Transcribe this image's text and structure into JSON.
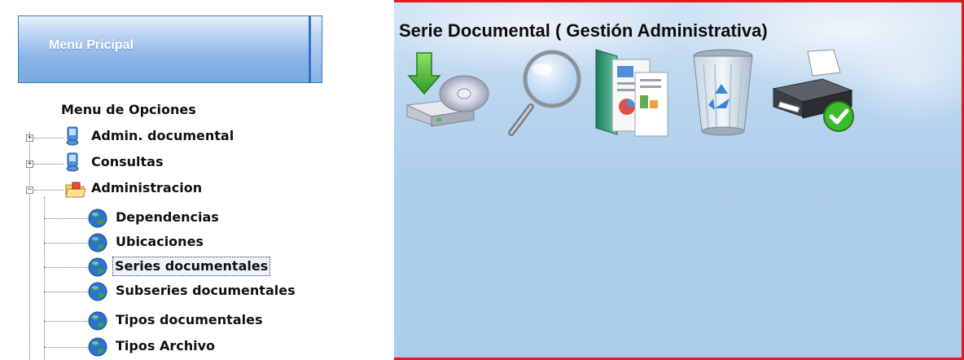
{
  "sidebar": {
    "header_title": "Menú Pricipal",
    "tree_title": "Menu de Opciones",
    "nodes": [
      {
        "label": "Admin. documental",
        "expander": "+",
        "icon": "monitor-icon"
      },
      {
        "label": "Consultas",
        "expander": "+",
        "icon": "monitor-icon"
      },
      {
        "label": "Administracion",
        "expander": "−",
        "icon": "open-folder-icon"
      }
    ],
    "children": [
      {
        "label": "Dependencias",
        "icon": "globe-icon"
      },
      {
        "label": "Ubicaciones",
        "icon": "globe-icon"
      },
      {
        "label": "Series documentales",
        "icon": "globe-icon",
        "selected": true
      },
      {
        "label": "Subseries documentales",
        "icon": "globe-icon"
      },
      {
        "label": "Tipos documentales",
        "icon": "globe-icon"
      },
      {
        "label": "Tipos Archivo",
        "icon": "globe-icon"
      }
    ]
  },
  "main": {
    "title": "Serie Documental ( Gestión Administrativa)",
    "toolbar": [
      {
        "name": "save-tool",
        "icon": "disk-save-icon"
      },
      {
        "name": "search-tool",
        "icon": "magnifier-icon"
      },
      {
        "name": "documents-tool",
        "icon": "documents-icon"
      },
      {
        "name": "delete-tool",
        "icon": "recycle-bin-icon"
      },
      {
        "name": "print-tool",
        "icon": "printer-icon"
      }
    ]
  },
  "colors": {
    "frame_border": "#e01b1b",
    "header_blue": "#8ab6e6",
    "panel_sky": "#abcdeb"
  }
}
